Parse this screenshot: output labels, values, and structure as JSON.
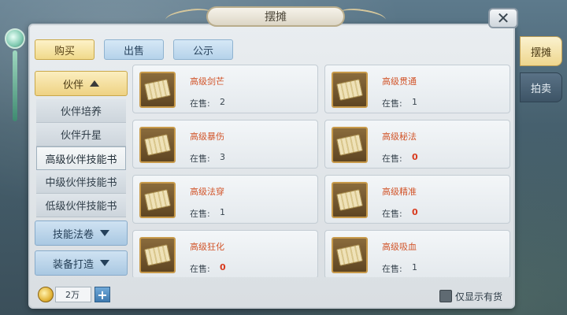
{
  "window": {
    "title": "摆摊",
    "close_glyph": "✕"
  },
  "tabs": [
    {
      "label": "购买",
      "active": true
    },
    {
      "label": "出售",
      "active": false
    },
    {
      "label": "公示",
      "active": false
    }
  ],
  "side_tabs": [
    {
      "label": "摆摊",
      "active": true
    },
    {
      "label": "拍卖",
      "active": false
    }
  ],
  "sidebar": {
    "open_category": "伙伴",
    "sub_items": [
      "伙伴培养",
      "伙伴升星",
      "高级伙伴技能书",
      "中级伙伴技能书",
      "低级伙伴技能书"
    ],
    "selected_sub": "高级伙伴技能书",
    "closed_categories": [
      "技能法卷",
      "装备打造"
    ]
  },
  "items": [
    {
      "name": "高级剑芒",
      "stock_label": "在售:",
      "stock": "2"
    },
    {
      "name": "高级贯通",
      "stock_label": "在售:",
      "stock": "1"
    },
    {
      "name": "高级暴伤",
      "stock_label": "在售:",
      "stock": "3"
    },
    {
      "name": "高级秘法",
      "stock_label": "在售:",
      "stock": "0"
    },
    {
      "name": "高级法穿",
      "stock_label": "在售:",
      "stock": "1"
    },
    {
      "name": "高级精准",
      "stock_label": "在售:",
      "stock": "0"
    },
    {
      "name": "高级狂化",
      "stock_label": "在售:",
      "stock": "0"
    },
    {
      "name": "高级吸血",
      "stock_label": "在售:",
      "stock": "1"
    }
  ],
  "bottom": {
    "gold_amount": "2万",
    "plus_glyph": "+",
    "filter_label": "仅显示有货",
    "filter_checked": false
  },
  "colors": {
    "accent_gold": "#eed283",
    "tab_blue": "#b5d2ea",
    "zero_stock": "#d83a1e",
    "item_name": "#d2552a"
  }
}
